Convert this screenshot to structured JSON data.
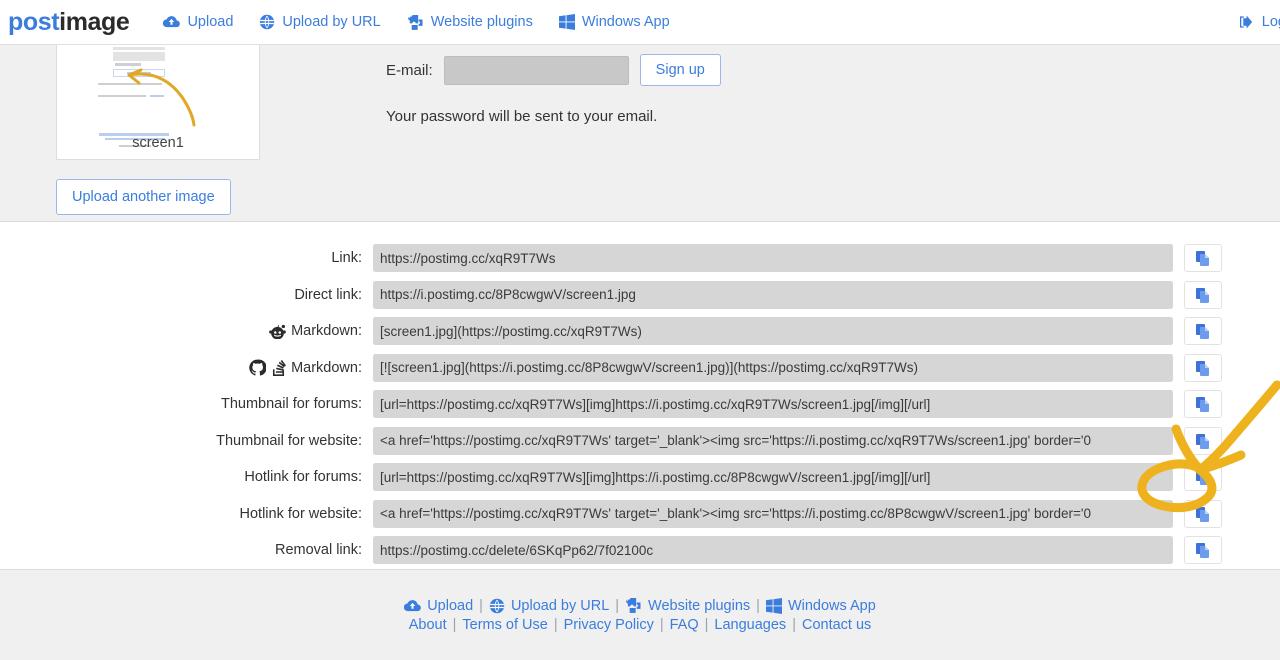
{
  "header": {
    "logo_post": "post",
    "logo_image": "image",
    "nav": [
      {
        "label": "Upload",
        "icon": "cloud-upload-icon"
      },
      {
        "label": "Upload by URL",
        "icon": "globe-icon"
      },
      {
        "label": "Website plugins",
        "icon": "puzzle-piece-icon"
      },
      {
        "label": "Windows App",
        "icon": "windows-logo-icon"
      }
    ],
    "login_label": "Log",
    "login_icon": "login-arrow-icon"
  },
  "upload_panel": {
    "thumbnail_caption": "screen1",
    "upload_another_label": "Upload another image",
    "signup": {
      "email_label": "E-mail:",
      "email_value": "",
      "email_placeholder": "",
      "signup_button": "Sign up",
      "note": "Your password will be sent to your email."
    }
  },
  "links": [
    {
      "label": "Link:",
      "icon": null,
      "value": "https://postimg.cc/xqR9T7Ws",
      "copy_icon": "copy-icon"
    },
    {
      "label": "Direct link:",
      "icon": null,
      "value": "https://i.postimg.cc/8P8cwgwV/screen1.jpg",
      "copy_icon": "copy-icon"
    },
    {
      "label": "Markdown:",
      "icon": "reddit-icon",
      "value": "[screen1.jpg](https://postimg.cc/xqR9T7Ws)",
      "copy_icon": "copy-icon"
    },
    {
      "label": "Markdown:",
      "icon": "github-stackoverflow-icon",
      "value": "[![screen1.jpg](https://i.postimg.cc/8P8cwgwV/screen1.jpg)](https://postimg.cc/xqR9T7Ws)",
      "copy_icon": "copy-icon"
    },
    {
      "label": "Thumbnail for forums:",
      "icon": null,
      "value": "[url=https://postimg.cc/xqR9T7Ws][img]https://i.postimg.cc/xqR9T7Ws/screen1.jpg[/img][/url]",
      "copy_icon": "copy-icon"
    },
    {
      "label": "Thumbnail for website:",
      "icon": null,
      "value": "<a href='https://postimg.cc/xqR9T7Ws' target='_blank'><img src='https://i.postimg.cc/xqR9T7Ws/screen1.jpg' border='0",
      "copy_icon": "copy-icon"
    },
    {
      "label": "Hotlink for forums:",
      "icon": null,
      "value": "[url=https://postimg.cc/xqR9T7Ws][img]https://i.postimg.cc/8P8cwgwV/screen1.jpg[/img][/url]",
      "copy_icon": "copy-icon"
    },
    {
      "label": "Hotlink for website:",
      "icon": null,
      "value": "<a href='https://postimg.cc/xqR9T7Ws' target='_blank'><img src='https://i.postimg.cc/8P8cwgwV/screen1.jpg' border='0",
      "copy_icon": "copy-icon"
    },
    {
      "label": "Removal link:",
      "icon": null,
      "value": "https://postimg.cc/delete/6SKqPp62/7f02100c",
      "copy_icon": "copy-icon"
    }
  ],
  "footer": {
    "row1": [
      {
        "label": "Upload",
        "icon": "cloud-upload-icon"
      },
      {
        "label": "Upload by URL",
        "icon": "globe-icon"
      },
      {
        "label": "Website plugins",
        "icon": "puzzle-piece-icon"
      },
      {
        "label": "Windows App",
        "icon": "windows-logo-icon"
      }
    ],
    "row2": [
      {
        "label": "About"
      },
      {
        "label": "Terms of Use"
      },
      {
        "label": "Privacy Policy"
      },
      {
        "label": "FAQ"
      },
      {
        "label": "Languages"
      },
      {
        "label": "Contact us"
      }
    ],
    "separator": "|"
  },
  "annotation": {
    "color": "#efb21f",
    "shapes": "hand-drawn arrow and ellipse highlighting the Hotlink for forums copy button"
  }
}
